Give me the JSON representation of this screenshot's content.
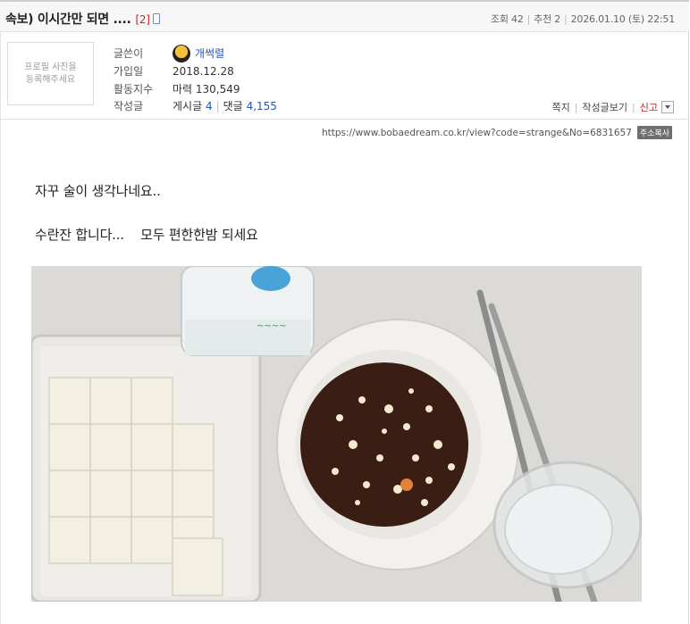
{
  "post": {
    "title": "속보) 이시간만 되면 ....",
    "comment_count": "[2]",
    "views_label": "조회 42",
    "recommend_label": "추천 2",
    "datetime": "2026.01.10 (토) 22:51"
  },
  "profile": {
    "placeholder": "프로필 사진을\n등록해주세요"
  },
  "author": {
    "writer_label": "글쓴이",
    "nickname": "개썩렬",
    "joined_label": "가입일",
    "joined_value": "2018.12.28",
    "activity_label": "활동지수",
    "activity_value": "마력 130,549",
    "posts_label": "작성글",
    "posts_prefix": "게시글",
    "posts_count": "4",
    "comments_prefix": "댓글",
    "comments_count": "4,155"
  },
  "actions": {
    "message": "쪽지",
    "view_posts": "작성글보기",
    "report": "신고"
  },
  "url": {
    "text": "https://www.bobaedream.co.kr/view?code=strange&No=6831657",
    "copy_label": "주소복사"
  },
  "content": {
    "line1": "자꾸 술이 생각나네요..",
    "line2": "수란잔 합니다...    모두 편한한밤 되세요"
  },
  "colors": {
    "link_blue": "#2a55b3",
    "alert_red": "#c8231e"
  }
}
